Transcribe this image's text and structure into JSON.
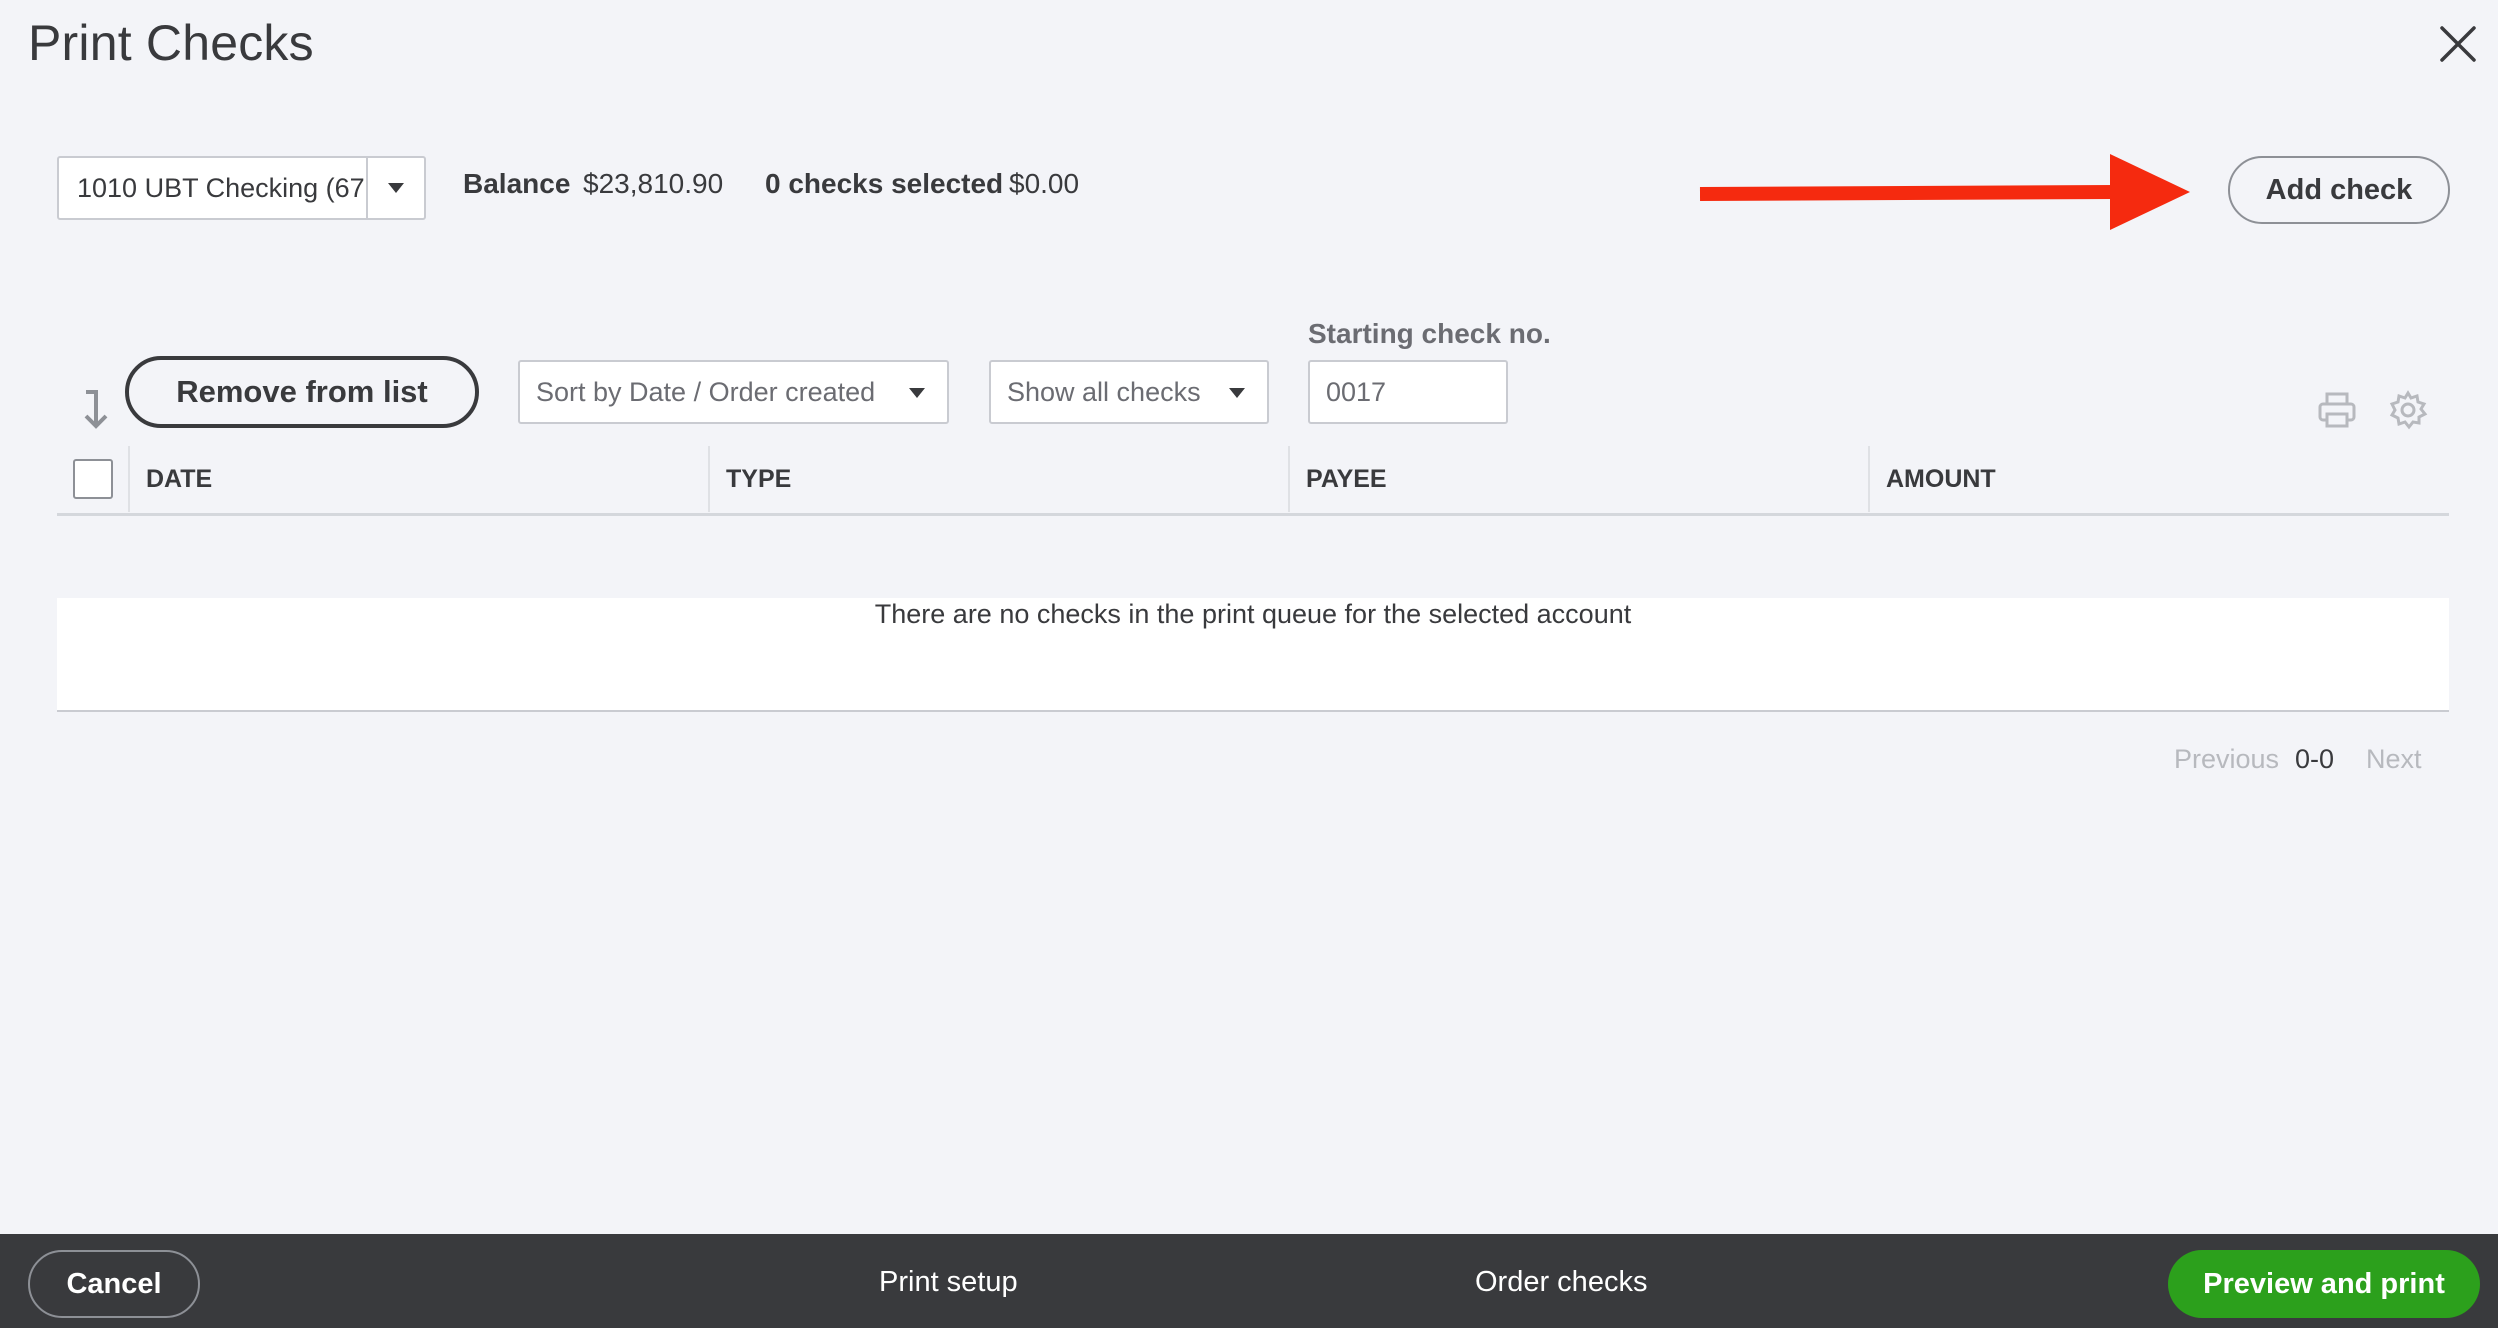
{
  "dialog": {
    "title": "Print Checks"
  },
  "account": {
    "selected": "1010 UBT Checking (67",
    "balance_label": "Balance",
    "balance_value": "$23,810.90",
    "selected_count_label": "0 checks selected",
    "selected_total": "$0.00"
  },
  "actions": {
    "add_check": "Add check",
    "remove_from_list": "Remove from list"
  },
  "filters": {
    "sort_value": "Sort by Date / Order created",
    "show_value": "Show all checks",
    "starting_check_label": "Starting check no.",
    "starting_check_value": "0017"
  },
  "table": {
    "columns": [
      "DATE",
      "TYPE",
      "PAYEE",
      "AMOUNT"
    ],
    "empty_message": "There are no checks in the print queue for the selected account"
  },
  "pagination": {
    "previous": "Previous",
    "range": "0-0",
    "next": "Next"
  },
  "footer": {
    "cancel": "Cancel",
    "print_setup": "Print setup",
    "order_checks": "Order checks",
    "preview_and_print": "Preview and print"
  },
  "icons": {
    "close": "close-icon",
    "dropdown": "chevron-down-icon",
    "sort": "sort-arrow-icon",
    "print": "print-icon",
    "settings": "gear-icon",
    "annotation": "red-arrow"
  },
  "colors": {
    "background": "#f3f4f8",
    "text": "#393a3d",
    "footer": "#393a3d",
    "primary_button": "#2ca01c",
    "annotation_arrow": "#f52a0f",
    "muted": "#b7b9be"
  }
}
